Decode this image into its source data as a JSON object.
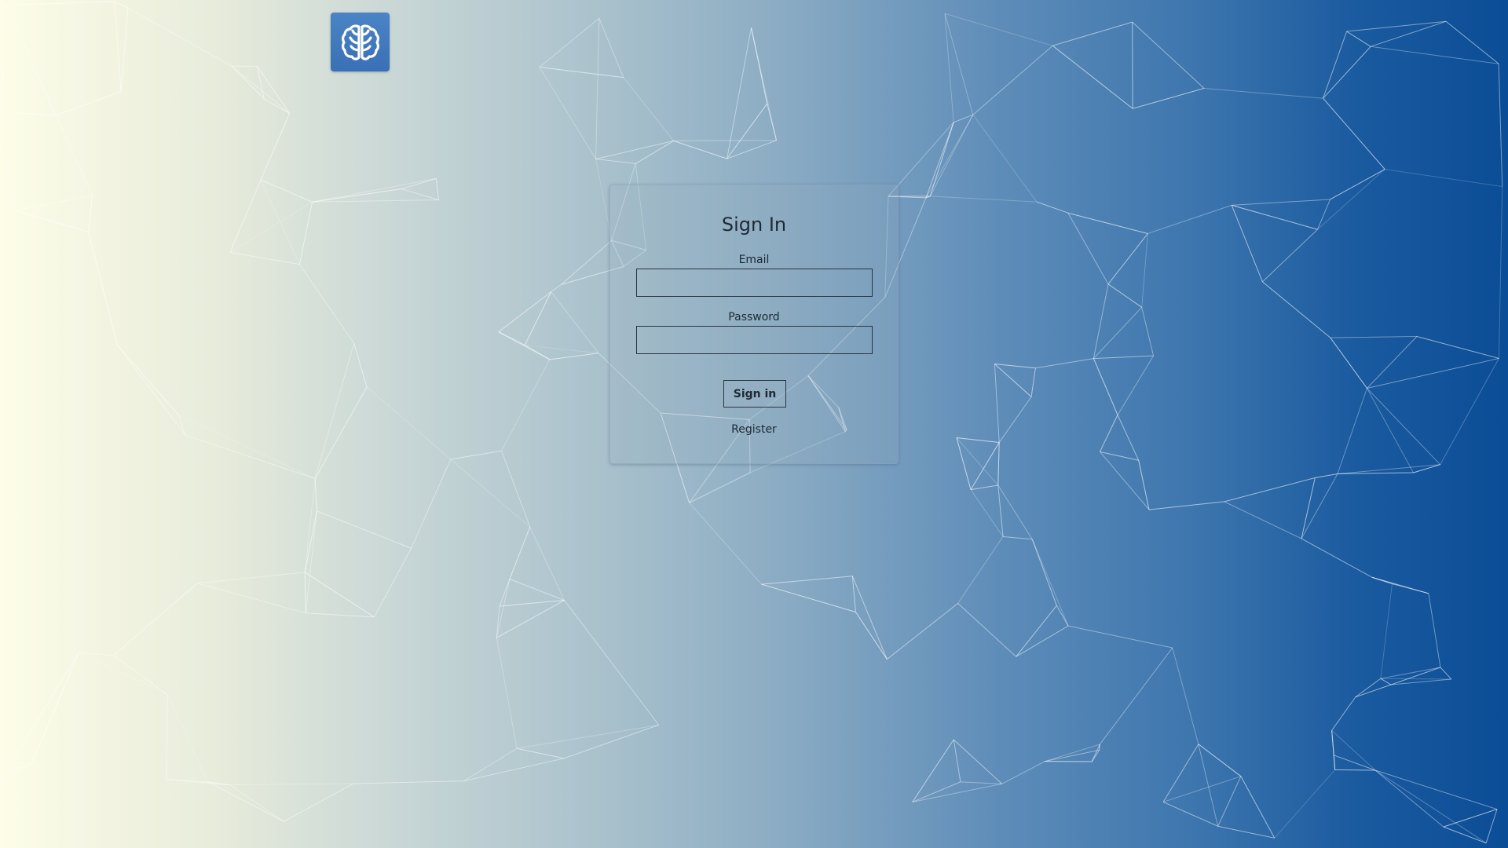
{
  "colors": {
    "gradient_left": "#fdfde8",
    "gradient_right": "#0b4d96",
    "logo_background": "#3a70b6",
    "text": "#1f2a35"
  },
  "logo": {
    "icon": "brain-icon"
  },
  "signin": {
    "title": "Sign In",
    "email_label": "Email",
    "email_value": "",
    "password_label": "Password",
    "password_value": "",
    "button_label": "Sign in",
    "register_link": "Register"
  }
}
